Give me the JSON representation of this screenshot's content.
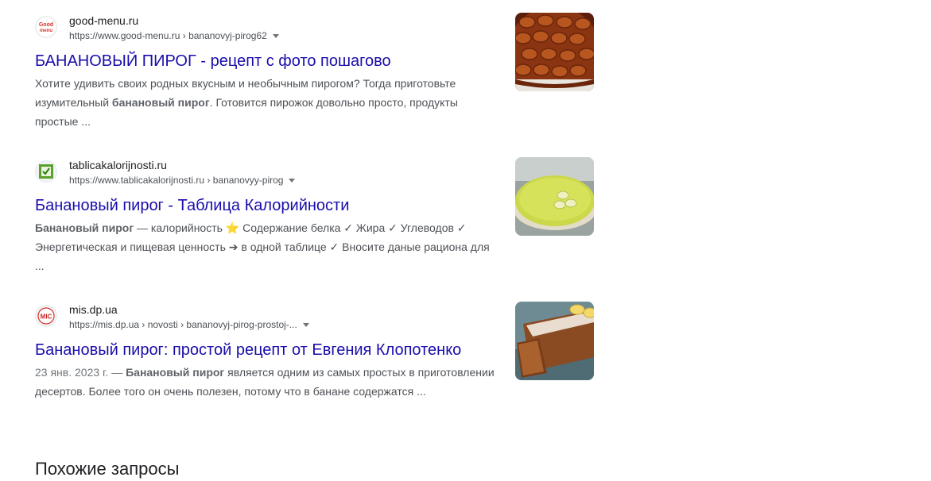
{
  "results": [
    {
      "favicon": "good-menu-logo-icon",
      "site_name": "good-menu.ru",
      "url": "https://www.good-menu.ru › bananovyj-pirog62",
      "title": "БАНАНОВЫЙ ПИРОГ - рецепт с фото пошагово",
      "snippet_parts": {
        "p1": "Хотите удивить своих родных вкусным и необычным пирогом? Тогда приготовьте изумительный ",
        "b1": "банановый пирог",
        "p2": ". Готовится пирожок довольно просто, продукты простые ..."
      },
      "thumbnail": "caramelized-banana-tart-image"
    },
    {
      "favicon": "green-checkbox-icon",
      "site_name": "tablicakalorijnosti.ru",
      "url": "https://www.tablicakalorijnosti.ru › bananovyy-pirog",
      "title": "Банановый пирог - Таблица Калорийности",
      "snippet_parts": {
        "b1": "Банановый пирог",
        "p1": " — калорийность ⭐ Содержание белка ✓ Жира ✓ Углеводов ✓ Энергетическая и пищевая ценность ➔ в одной таблице ✓ Вносите даные рациона для ..."
      },
      "thumbnail": "green-banana-cheesecake-image"
    },
    {
      "favicon": "mis-logo-icon",
      "site_name": "mis.dp.ua",
      "url": "https://mis.dp.ua › novosti › bananovyj-pirog-prostoj-...",
      "title": "Банановый пирог: простой рецепт от Евгения Клопотенко",
      "snippet_parts": {
        "date": "23 янв. 2023 г. — ",
        "b1": "Банановый пирог",
        "p1": " является одним из самых простых в приготовлении десертов. Более того он очень полезен, потому что в банане содержатся ..."
      },
      "thumbnail": "banana-bread-loaf-image"
    }
  ],
  "favicon_texts": {
    "good_menu": "Good menu",
    "mis": "MIC"
  },
  "related_heading": "Похожие запросы",
  "colors": {
    "link": "#1a0dab",
    "text": "#4d5156",
    "title_text": "#202124"
  }
}
